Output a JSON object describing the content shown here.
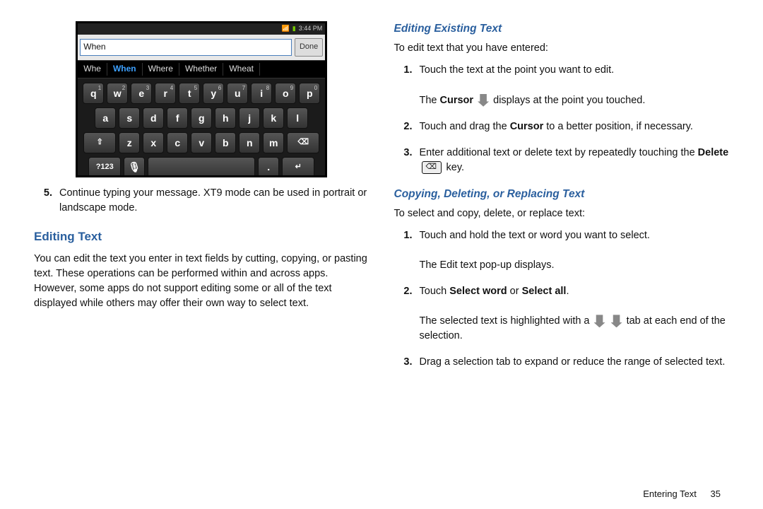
{
  "screenshot": {
    "status_time": "3:44 PM",
    "input_value": "When",
    "done_label": "Done",
    "suggestions": [
      "Whe",
      "When",
      "Where",
      "Whether",
      "Wheat"
    ],
    "suggestion_selected_index": 1,
    "row1": [
      "q",
      "w",
      "e",
      "r",
      "t",
      "y",
      "u",
      "i",
      "o",
      "p"
    ],
    "row1_sup": [
      "1",
      "2",
      "3",
      "4",
      "5",
      "6",
      "7",
      "8",
      "9",
      "0"
    ],
    "row2": [
      "a",
      "s",
      "d",
      "f",
      "g",
      "h",
      "j",
      "k",
      "l"
    ],
    "row3": [
      "z",
      "x",
      "c",
      "v",
      "b",
      "n",
      "m"
    ],
    "shift_label": "⇧",
    "del_label": "⌫",
    "sym_label": "?123",
    "mic_label": "🎙",
    "enter_label": "↵"
  },
  "left": {
    "item5_num": "5.",
    "item5_text": "Continue typing your message. XT9 mode can be used in portrait or landscape mode.",
    "heading_editing_text": "Editing Text",
    "editing_text_body": "You can edit the text you enter in text fields by cutting, copying, or pasting text. These operations can be performed within and across apps. However, some apps do not support editing some or all of the text displayed while others may offer their own way to select text."
  },
  "right": {
    "heading_editing_existing": "Editing Existing Text",
    "intro_edit": "To edit text that you have entered:",
    "s1_num": "1.",
    "s1_line1": "Touch the text at the point you want to edit.",
    "s1_line2a": "The ",
    "s1_cursor": "Cursor",
    "s1_line2b": " displays at the point you touched.",
    "s2_num": "2.",
    "s2_a": "Touch and drag the ",
    "s2_cursor": "Cursor",
    "s2_b": " to a better position, if necessary.",
    "s3_num": "3.",
    "s3_a": "Enter additional text or delete text by repeatedly touching the ",
    "s3_delete": "Delete",
    "s3_b": " key.",
    "heading_copying": "Copying, Deleting, or Replacing Text",
    "intro_copy": "To select and copy, delete, or replace text:",
    "c1_num": "1.",
    "c1_line1": "Touch and hold the text or word you want to select.",
    "c1_line2": "The Edit text pop-up displays.",
    "c2_num": "2.",
    "c2_a": "Touch ",
    "c2_sw": "Select word",
    "c2_or": " or ",
    "c2_sa": "Select all",
    "c2_dot": ".",
    "c2_line2a": "The selected text is highlighted with a ",
    "c2_line2b": " tab at each end of the selection.",
    "c3_num": "3.",
    "c3_text": "Drag a selection tab to expand or reduce the range of selected text."
  },
  "footer": {
    "section": "Entering Text",
    "page": "35"
  }
}
